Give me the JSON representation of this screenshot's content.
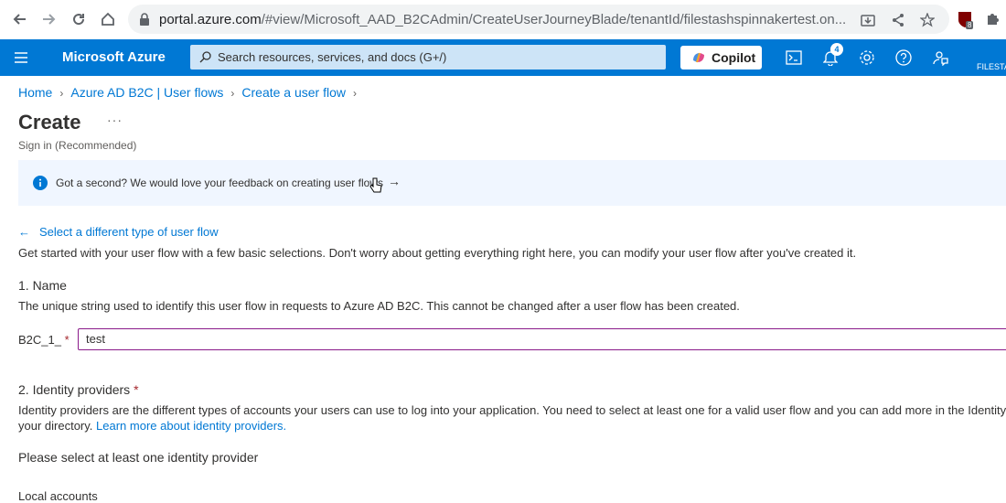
{
  "browser": {
    "url_host": "portal.azure.com",
    "url_path": "/#view/Microsoft_AAD_B2CAdmin/CreateUserJourneyBlade/tenantId/filestashspinnakertest.on...",
    "ext_badge": "8"
  },
  "azure_bar": {
    "brand": "Microsoft Azure",
    "search_placeholder": "Search resources, services, and docs (G+/)",
    "copilot_label": "Copilot",
    "notifications_count": "4",
    "account_label": "FILESTA"
  },
  "breadcrumb": [
    "Home",
    "Azure AD B2C | User flows",
    "Create a user flow"
  ],
  "page": {
    "title": "Create",
    "more": "···",
    "subtitle": "Sign in (Recommended)",
    "banner_text": "Got a second? We would love your feedback on creating user flows",
    "banner_arrow": "→",
    "back_link": "Select a different type of user flow",
    "intro": "Get started with your user flow with a few basic selections. Don't worry about getting everything right here, you can modify your user flow after you've created it."
  },
  "name_section": {
    "heading": "1. Name",
    "description": "The unique string used to identify this user flow in requests to Azure AD B2C. This cannot be changed after a user flow has been created.",
    "prefix": "B2C_1_",
    "required_mark": "*",
    "value": "test"
  },
  "idp_section": {
    "heading": "2. Identity providers",
    "required_mark": "*",
    "description_line1": "Identity providers are the different types of accounts your users can use to log into your application. You need to select at least one for a valid user flow and you can add more in the Identity",
    "description_line2": "your directory.",
    "learn_more": "Learn more about identity providers.",
    "prompt": "Please select at least one identity provider",
    "local_accounts": "Local accounts"
  }
}
